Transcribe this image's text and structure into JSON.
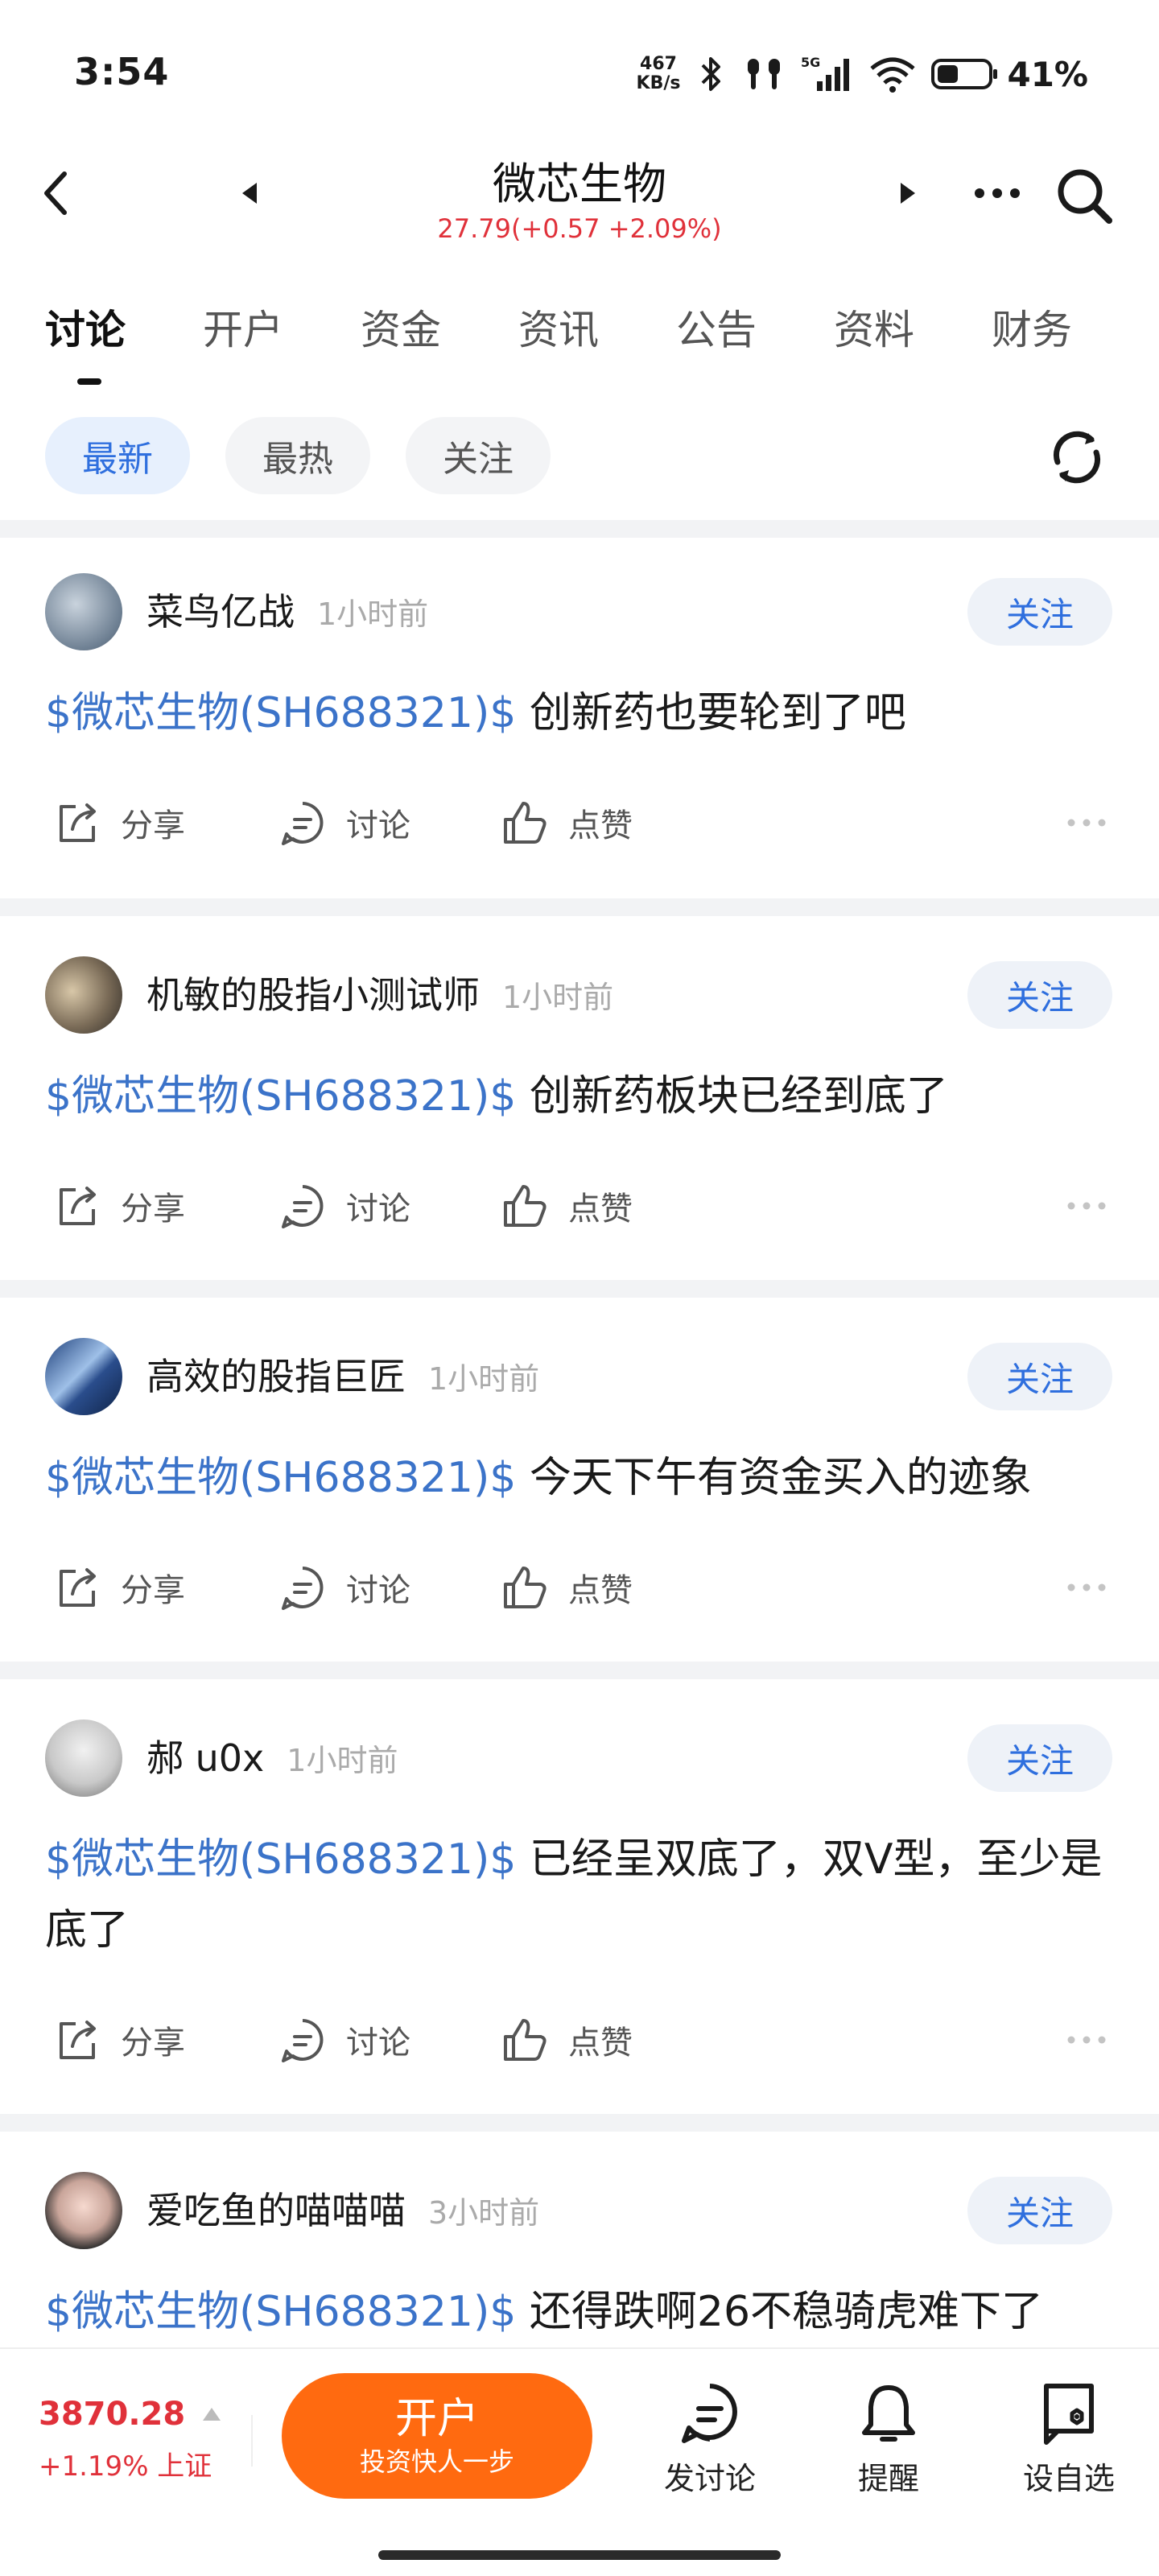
{
  "status_bar": {
    "time": "3:54",
    "net_speed_value": "467",
    "net_speed_unit": "KB/s",
    "network": "5G",
    "battery_pct": "41%",
    "battery_level": 0.41
  },
  "header": {
    "title": "微芯生物",
    "price_line": "27.79(+0.57 +2.09%)"
  },
  "tabs": [
    {
      "label": "讨论",
      "active": true
    },
    {
      "label": "开户"
    },
    {
      "label": "资金"
    },
    {
      "label": "资讯"
    },
    {
      "label": "公告"
    },
    {
      "label": "资料"
    },
    {
      "label": "财务"
    }
  ],
  "filters": [
    {
      "label": "最新",
      "active": true
    },
    {
      "label": "最热"
    },
    {
      "label": "关注"
    }
  ],
  "posts": [
    {
      "user": "菜鸟亿战",
      "time": "1小时前",
      "follow": "关注",
      "stock": "$微芯生物(SH688321)$",
      "text": " 创新药也要轮到了吧",
      "share": "分享",
      "comment": "讨论",
      "like": "点赞"
    },
    {
      "user": "机敏的股指小测试师",
      "time": "1小时前",
      "follow": "关注",
      "stock": "$微芯生物(SH688321)$",
      "text": " 创新药板块已经到底了",
      "share": "分享",
      "comment": "讨论",
      "like": "点赞"
    },
    {
      "user": "高效的股指巨匠",
      "time": "1小时前",
      "follow": "关注",
      "stock": "$微芯生物(SH688321)$",
      "text": " 今天下午有资金买入的迹象",
      "share": "分享",
      "comment": "讨论",
      "like": "点赞"
    },
    {
      "user": "郝 u0x",
      "time": "1小时前",
      "follow": "关注",
      "stock": "$微芯生物(SH688321)$",
      "text": " 已经呈双底了，双V型，至少是底了",
      "share": "分享",
      "comment": "讨论",
      "like": "点赞"
    },
    {
      "user": "爱吃鱼的喵喵喵",
      "time": "3小时前",
      "follow": "关注",
      "stock": "$微芯生物(SH688321)$",
      "text": " 还得跌啊26不稳骑虎难下了"
    }
  ],
  "bottom_bar": {
    "index_value": "3870.28",
    "index_change": "+1.19% 上证",
    "open_account_title": "开户",
    "open_account_sub": "投资快人一步",
    "post_label": "发讨论",
    "alert_label": "提醒",
    "watchlist_label": "设自选"
  },
  "colors": {
    "accent_blue": "#2f6fde",
    "stock_link": "#3b73c9",
    "price_red": "#e0313a",
    "cta_orange": "#ff6a10"
  }
}
